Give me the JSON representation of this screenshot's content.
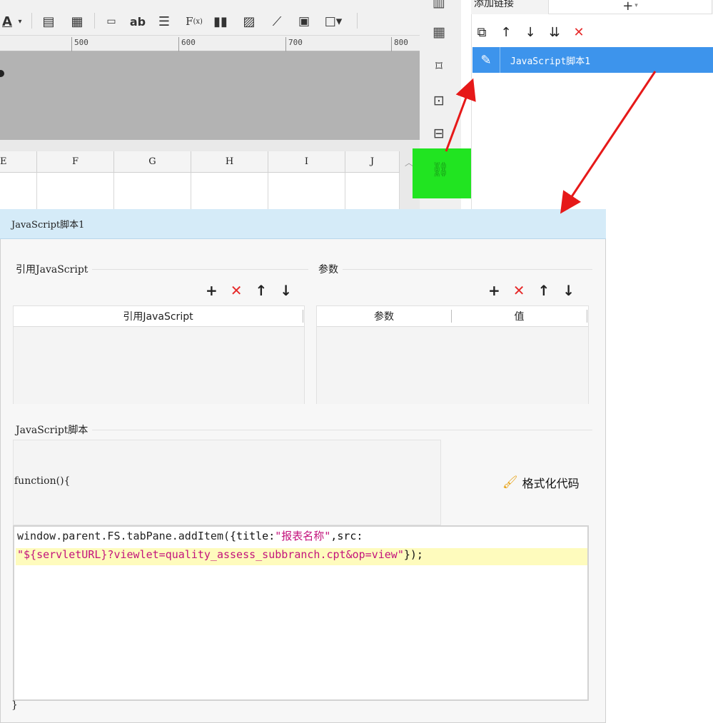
{
  "toolbar": {
    "ruler_labels": [
      "500",
      "600",
      "700",
      "800"
    ]
  },
  "sheet": {
    "columns": [
      "E",
      "F",
      "G",
      "H",
      "I",
      "J"
    ]
  },
  "link_panel": {
    "title": "添加链接",
    "add_button": "+",
    "item_label": "JavaScript脚本1"
  },
  "dialog": {
    "title": "JavaScript脚本1",
    "ref_section": "引用JavaScript",
    "ref_column": "引用JavaScript",
    "param_section": "参数",
    "param_col_name": "参数",
    "param_col_value": "值",
    "script_section": "JavaScript脚本",
    "func_open": "function(){",
    "format_label": "格式化代码",
    "code_line1_a": "window.parent.FS.tabPane.addItem(",
    "code_line1_b": "{title:",
    "code_line1_c": "\"报表名称\"",
    "code_line1_d": ",src:",
    "code_line2_a": "\"${servletURL}?viewlet=quality_assess_subbranch.cpt&op=view\"",
    "code_line2_b": "});",
    "func_close": "}"
  },
  "colors": {
    "highlight_green": "#21e421",
    "selected_blue": "#3d94ec",
    "dialog_header": "#d5ebf8",
    "arrow_red": "#e61919",
    "delete_red": "#e62a2a",
    "code_pink": "#c3137c"
  }
}
